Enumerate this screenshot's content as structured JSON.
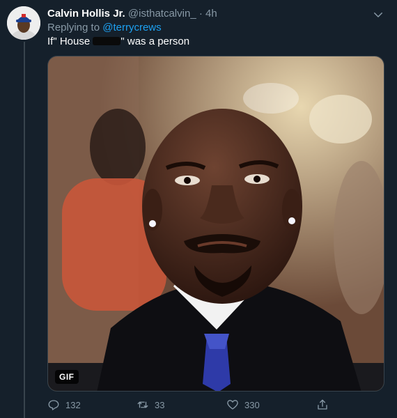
{
  "tweet": {
    "author_name": "Calvin Hollis Jr.",
    "author_handle": "@isthatcalvin_",
    "separator": "·",
    "time": "4h",
    "replying_prefix": "Replying to",
    "replying_to": "@terrycrews",
    "text_before": "If\" House ",
    "text_partial": "\"",
    "text_after": " was a person",
    "media_badge": "GIF"
  },
  "actions": {
    "reply_count": "132",
    "retweet_count": "33",
    "like_count": "330"
  },
  "icons": {
    "caret": "chevron-down-icon",
    "reply": "reply-icon",
    "retweet": "retweet-icon",
    "like": "heart-icon",
    "share": "share-icon"
  },
  "colors": {
    "background": "#15202b",
    "accent": "#1da1f2",
    "secondary_text": "#8899a6",
    "primary_text": "#ffffff"
  }
}
